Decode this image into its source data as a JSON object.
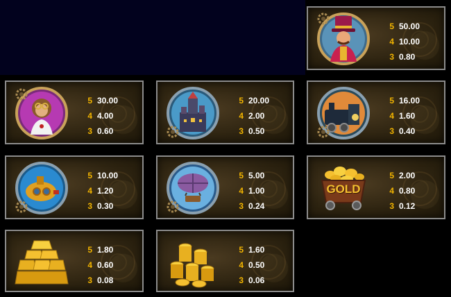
{
  "colors": {
    "background": "#000000",
    "navy_area": "#02021e",
    "card_border": "#8c8c8c",
    "count_color": "#f2b400",
    "value_color": "#ffffff"
  },
  "paytable": [
    {
      "symbol": "ringmaster",
      "icon": "ringmaster-icon",
      "pays": [
        {
          "count": "5",
          "value": "50.00"
        },
        {
          "count": "4",
          "value": "10.00"
        },
        {
          "count": "3",
          "value": "0.80"
        }
      ]
    },
    {
      "symbol": "monkey",
      "icon": "monkey-icon",
      "pays": [
        {
          "count": "5",
          "value": "30.00"
        },
        {
          "count": "4",
          "value": "4.00"
        },
        {
          "count": "3",
          "value": "0.60"
        }
      ]
    },
    {
      "symbol": "steampunk-city",
      "icon": "city-icon",
      "pays": [
        {
          "count": "5",
          "value": "20.00"
        },
        {
          "count": "4",
          "value": "2.00"
        },
        {
          "count": "3",
          "value": "0.50"
        }
      ]
    },
    {
      "symbol": "locomotive",
      "icon": "locomotive-icon",
      "pays": [
        {
          "count": "5",
          "value": "16.00"
        },
        {
          "count": "4",
          "value": "1.60"
        },
        {
          "count": "3",
          "value": "0.40"
        }
      ]
    },
    {
      "symbol": "submarine",
      "icon": "submarine-icon",
      "pays": [
        {
          "count": "5",
          "value": "10.00"
        },
        {
          "count": "4",
          "value": "1.20"
        },
        {
          "count": "3",
          "value": "0.30"
        }
      ]
    },
    {
      "symbol": "airship",
      "icon": "airship-icon",
      "pays": [
        {
          "count": "5",
          "value": "5.00"
        },
        {
          "count": "4",
          "value": "1.00"
        },
        {
          "count": "3",
          "value": "0.24"
        }
      ]
    },
    {
      "symbol": "gold-cart",
      "icon": "gold-cart-icon",
      "label": "GOLD",
      "pays": [
        {
          "count": "5",
          "value": "2.00"
        },
        {
          "count": "4",
          "value": "0.80"
        },
        {
          "count": "3",
          "value": "0.12"
        }
      ]
    },
    {
      "symbol": "gold-bars",
      "icon": "gold-bars-icon",
      "pays": [
        {
          "count": "5",
          "value": "1.80"
        },
        {
          "count": "4",
          "value": "0.60"
        },
        {
          "count": "3",
          "value": "0.08"
        }
      ]
    },
    {
      "symbol": "gold-coins",
      "icon": "gold-coins-icon",
      "pays": [
        {
          "count": "5",
          "value": "1.60"
        },
        {
          "count": "4",
          "value": "0.50"
        },
        {
          "count": "3",
          "value": "0.06"
        }
      ]
    }
  ]
}
